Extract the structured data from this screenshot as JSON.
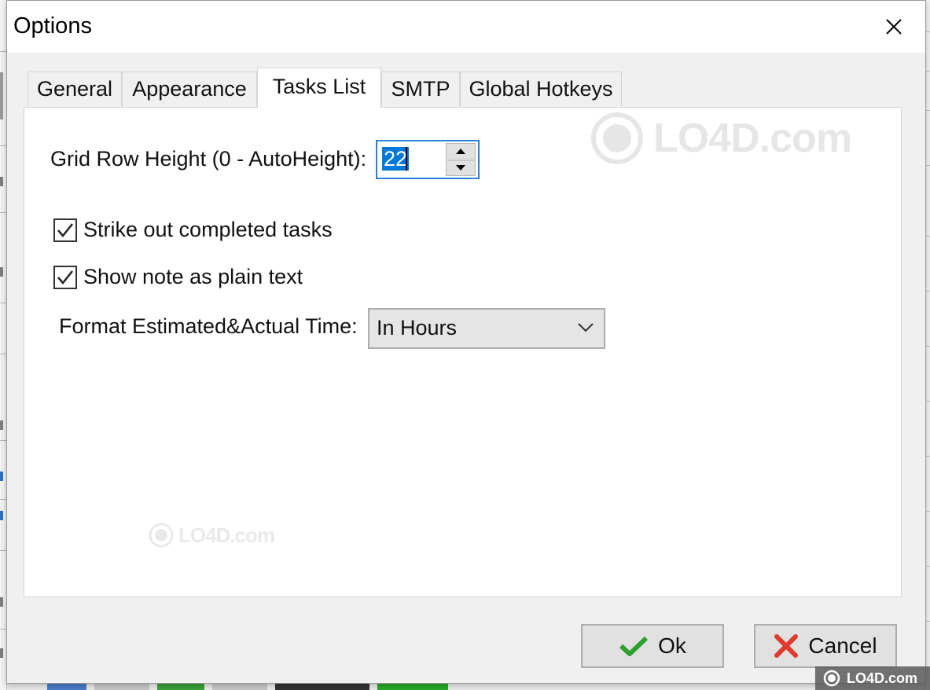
{
  "window": {
    "title": "Options"
  },
  "tabs": [
    {
      "label": "General",
      "active": false
    },
    {
      "label": "Appearance",
      "active": false
    },
    {
      "label": "Tasks List",
      "active": true
    },
    {
      "label": "SMTP",
      "active": false
    },
    {
      "label": "Global Hotkeys",
      "active": false
    }
  ],
  "tasks_list": {
    "grid_row_height": {
      "label": "Grid Row Height (0 - AutoHeight):",
      "value": "22"
    },
    "strike_out": {
      "label": "Strike out completed tasks",
      "checked": true
    },
    "show_note_plain": {
      "label": "Show note as plain text",
      "checked": true
    },
    "format_time": {
      "label": "Format Estimated&Actual Time:",
      "selected": "In Hours"
    }
  },
  "buttons": {
    "ok": "Ok",
    "cancel": "Cancel"
  },
  "watermark": {
    "text": "LO4D.com"
  },
  "colors": {
    "accent": "#0078d7",
    "ok_icon": "#2e9e2e",
    "cancel_icon": "#e03a2e"
  },
  "icons": {
    "close": "close-icon",
    "ok": "checkmark-icon",
    "cancel": "cross-icon",
    "dropdown": "chevron-down-icon"
  }
}
